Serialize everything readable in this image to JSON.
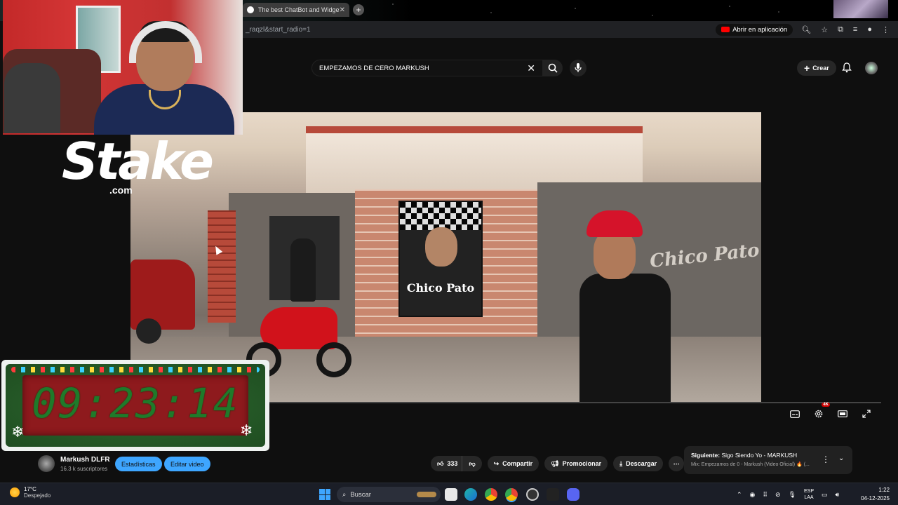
{
  "browser": {
    "tab_title": "The best ChatBot and Widgets",
    "url_fragment": "_raqzl&start_radio=1",
    "open_in_app": "Abrir en aplicación"
  },
  "youtube": {
    "search_query": "EMPEZAMOS DE CERO MARKUSH",
    "create_label": "Crear",
    "video_poster_text": "Chico Pato",
    "graffiti_text": "Chico Pato",
    "quality_badge": "4K",
    "channel": {
      "name": "Markush DLFR",
      "subscribers": "16.3 k suscriptores",
      "stats_button": "Estadísticas",
      "edit_button": "Editar video"
    },
    "actions": {
      "likes": "333",
      "share": "Compartir",
      "promote": "Promocionar",
      "download": "Descargar"
    },
    "next": {
      "label": "Siguiente:",
      "title": "Sigo Siendo Yo - MARKUSH",
      "mix": "Mix: Empezamos de 0 - Markush (Video Oficial) 🔥 (..."
    }
  },
  "overlay": {
    "sponsor_logo": "Stake",
    "sponsor_domain": ".com",
    "timer": "09:23:14"
  },
  "taskbar": {
    "temperature": "17°C",
    "condition": "Despejado",
    "search_placeholder": "Buscar",
    "lang_top": "ESP",
    "lang_bottom": "LAA",
    "time": "1:22",
    "date": "04-12-2025"
  },
  "colors": {
    "accent_blue": "#3ea6ff",
    "youtube_red": "#ff0000",
    "timer_green": "#1f7a2a",
    "timer_red": "#8e1a1d"
  }
}
